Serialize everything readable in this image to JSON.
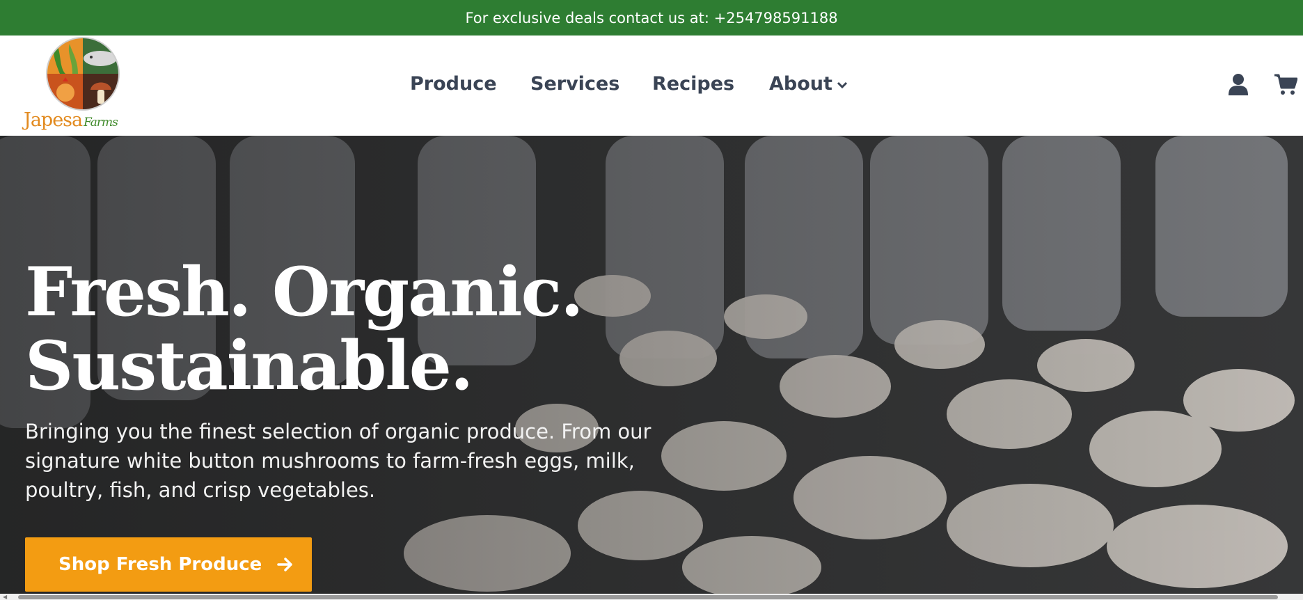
{
  "topbar": {
    "text": "For exclusive deals contact us at: +254798591188"
  },
  "logo": {
    "word1": "Japesa",
    "word2": "Farms"
  },
  "nav": {
    "items": [
      {
        "label": "Produce"
      },
      {
        "label": "Services"
      },
      {
        "label": "Recipes"
      },
      {
        "label": "About"
      }
    ]
  },
  "header_icons": {
    "account": "user-icon",
    "cart": "cart-icon"
  },
  "hero": {
    "title_line1": "Fresh. Organic.",
    "title_line2": "Sustainable.",
    "subtitle": "Bringing you the finest selection of organic produce. From our signature white button mushrooms to farm-fresh eggs, milk, poultry, fish, and crisp vegetables.",
    "cta_label": "Shop Fresh Produce"
  },
  "colors": {
    "topbar": "#2e7d32",
    "cta": "#f39c12",
    "nav_text": "#3a4455"
  }
}
